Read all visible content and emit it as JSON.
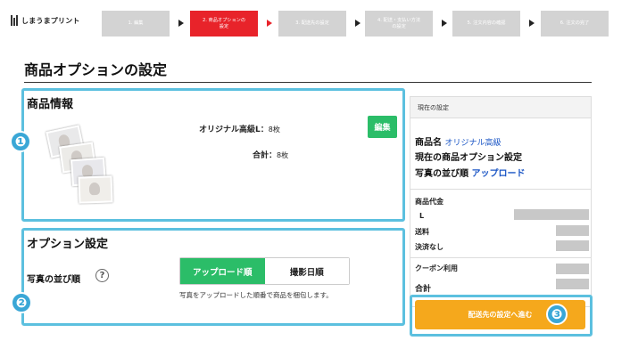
{
  "brand": {
    "name": "しまうまプリント"
  },
  "steps": [
    {
      "label": "1. 編集",
      "active": false
    },
    {
      "label": "2. 商品オプションの\n設定",
      "active": true
    },
    {
      "label": "3. 配送先の設定",
      "active": false
    },
    {
      "label": "4. 配送・支払い方法\nの設定",
      "active": false
    },
    {
      "label": "5. 注文内容の確認",
      "active": false
    },
    {
      "label": "6. 注文の完了",
      "active": false
    }
  ],
  "page_title": "商品オプションの設定",
  "product": {
    "title": "商品情報",
    "line_label": "オリジナル高級L：",
    "line_value": "8枚",
    "total_label": "合計：",
    "total_value": "8枚",
    "edit_label": "編集"
  },
  "options": {
    "title": "オプション設定",
    "sort_label": "写真の並び順",
    "help_icon": "?",
    "choices": [
      "アップロード順",
      "撮影日順"
    ],
    "selected": "アップロード順",
    "note": "写真をアップロードした順番で商品を梱包します。"
  },
  "summary": {
    "header": "現在の設定",
    "product_name_label": "商品名",
    "product_name_value": "オリジナル高級",
    "current_options_label": "現在の商品オプション設定",
    "sort_label": "写真の並び順",
    "sort_value": "アップロード",
    "price_label": "商品代金",
    "size_label": "L",
    "shipping_label": "送料",
    "payment_label": "決済なし",
    "coupon_label": "クーポン利用",
    "total_label": "合計"
  },
  "cta": {
    "label": "配送先の設定へ進む"
  },
  "badges": [
    "❶",
    "❷",
    "❸"
  ],
  "colors": {
    "accent_red": "#e8232a",
    "green": "#2bbd68",
    "orange": "#f5a81c",
    "highlight": "#5cc0df",
    "badge": "#3aa7d6"
  }
}
